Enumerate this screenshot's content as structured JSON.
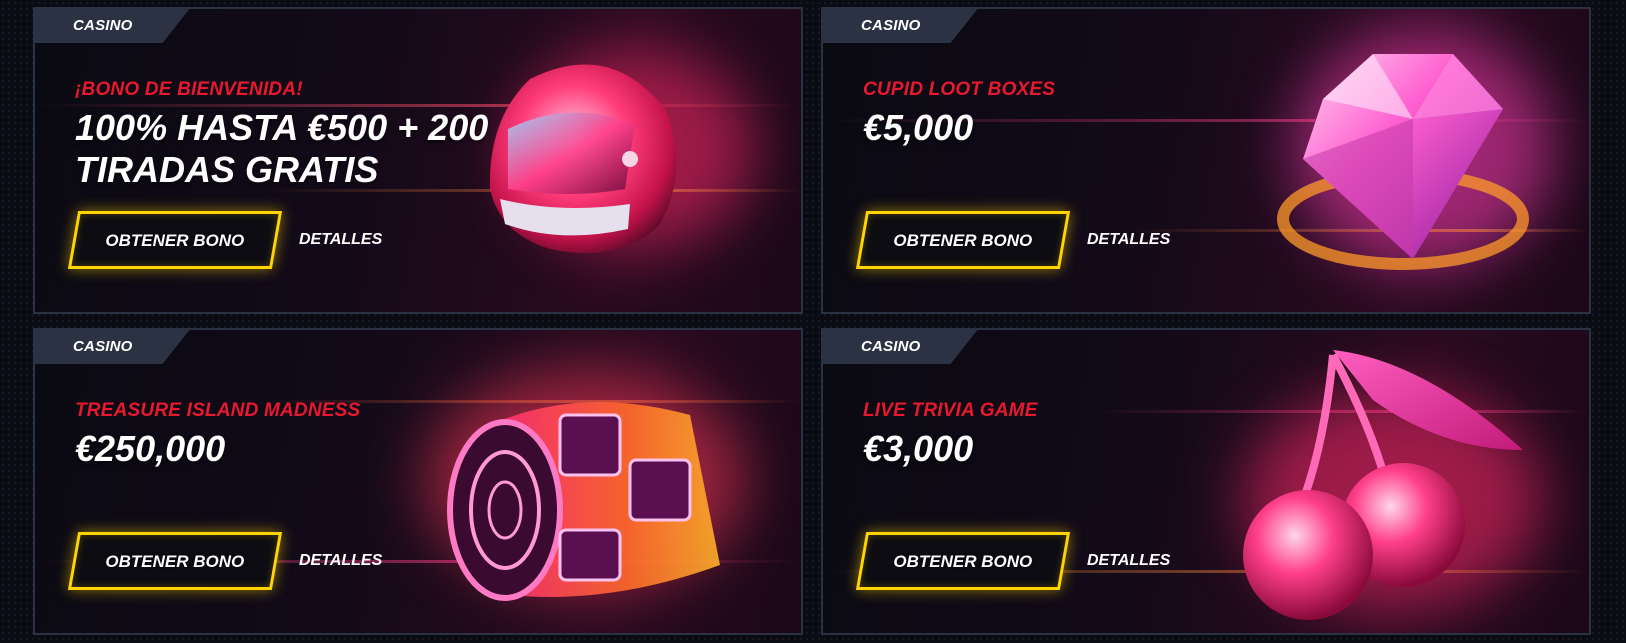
{
  "promos": [
    {
      "tag": "CASINO",
      "subtitle": "¡BONO DE BIENVENIDA!",
      "headline": "100% HASTA €500 + 200 TIRADAS GRATIS",
      "cta": "OBTENER BONO",
      "details": "DETALLES",
      "art_icon": "racing-helmet"
    },
    {
      "tag": "CASINO",
      "subtitle": "CUPID LOOT BOXES",
      "headline": "€5,000",
      "cta": "OBTENER BONO",
      "details": "DETALLES",
      "art_icon": "diamond"
    },
    {
      "tag": "CASINO",
      "subtitle": "TREASURE ISLAND MADNESS",
      "headline": "€250,000",
      "cta": "OBTENER BONO",
      "details": "DETALLES",
      "art_icon": "slot-reels"
    },
    {
      "tag": "CASINO",
      "subtitle": "LIVE TRIVIA GAME",
      "headline": "€3,000",
      "cta": "OBTENER BONO",
      "details": "DETALLES",
      "art_icon": "cherries"
    }
  ],
  "colors": {
    "accent_yellow": "#ffd400",
    "subtitle_red": "#e8182e",
    "tag_bg": "#2a3244",
    "card_border": "#2a3244"
  }
}
